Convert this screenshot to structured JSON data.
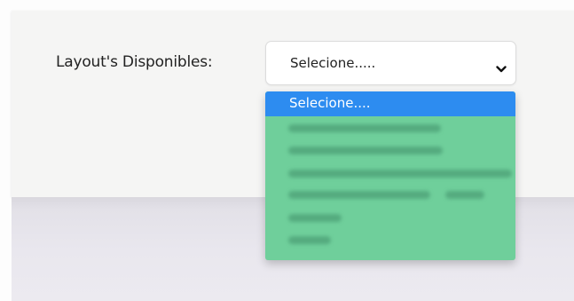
{
  "form": {
    "label": "Layout's Disponibles:",
    "select_value": "Selecione....."
  },
  "dropdown": {
    "options": [
      {
        "label": "Selecione....",
        "selected": true
      },
      {
        "label": "",
        "selected": false
      },
      {
        "label": "",
        "selected": false
      },
      {
        "label": "",
        "selected": false
      },
      {
        "label": "",
        "selected": false
      },
      {
        "label": "",
        "selected": false
      },
      {
        "label": "",
        "selected": false
      }
    ]
  },
  "colors": {
    "selected_option_bg": "#2d8cf0",
    "dropdown_bg": "#6fcf9b",
    "card_bg": "#f5f5f4"
  },
  "icons": {
    "select_chevron": "chevron-down-icon"
  }
}
